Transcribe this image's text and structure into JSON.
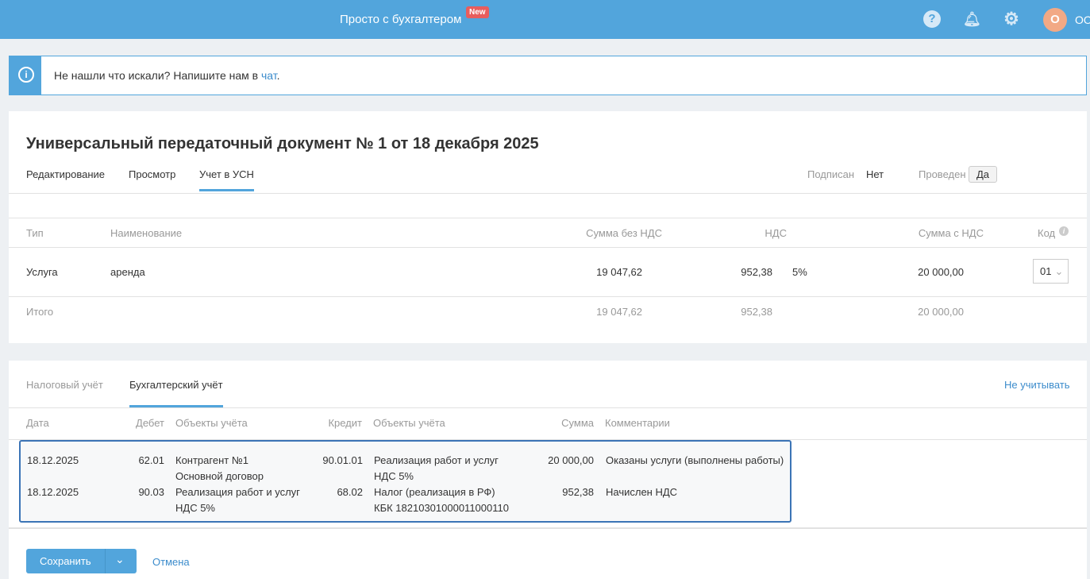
{
  "header": {
    "brand": "Просто с бухгалтером",
    "new_badge": "New",
    "avatar_letter": "О",
    "user": "ОО"
  },
  "info": {
    "text": "Не нашли что искали? Напишите нам в ",
    "link": "чат",
    "suffix": "."
  },
  "doc": {
    "title": "Универсальный передаточный документ № 1 от 18 декабря 2025",
    "tabs": [
      "Редактирование",
      "Просмотр",
      "Учет в УСН"
    ],
    "signed_label": "Подписан",
    "signed_value": "Нет",
    "posted_label": "Проведен",
    "posted_value": "Да",
    "columns": [
      "Тип",
      "Наименование",
      "Сумма без НДС",
      "НДС",
      "Сумма с НДС",
      "Код"
    ],
    "row": {
      "type": "Услуга",
      "name": "аренда",
      "net": "19 047,62",
      "vat": "952,38",
      "rate": "5%",
      "gross": "20 000,00",
      "code": "01"
    },
    "total": {
      "label": "Итого",
      "net": "19 047,62",
      "vat": "952,38",
      "gross": "20 000,00"
    }
  },
  "accounting": {
    "tabs": [
      "Налоговый учёт",
      "Бухгалтерский учёт"
    ],
    "ignore_link": "Не учитывать",
    "columns": [
      "Дата",
      "Дебет",
      "Объекты учёта",
      "Кредит",
      "Объекты учёта",
      "Сумма",
      "Комментарии"
    ],
    "entries": [
      {
        "date": "18.12.2025",
        "debit": "62.01",
        "debit_obj1": "Контрагент №1",
        "debit_obj2": "Основной договор",
        "credit": "90.01.01",
        "credit_obj1": "Реализация работ и услуг",
        "credit_obj2": "НДС 5%",
        "sum": "20 000,00",
        "comment": "Оказаны услуги (выполнены работы)"
      },
      {
        "date": "18.12.2025",
        "debit": "90.03",
        "debit_obj1": "Реализация работ и услуг",
        "debit_obj2": "НДС 5%",
        "credit": "68.02",
        "credit_obj1": "Налог (реализация в РФ)",
        "credit_obj2": "КБК 18210301000011000110",
        "sum": "952,38",
        "comment": "Начислен НДС"
      }
    ]
  },
  "footer": {
    "save": "Сохранить",
    "cancel": "Отмена"
  }
}
